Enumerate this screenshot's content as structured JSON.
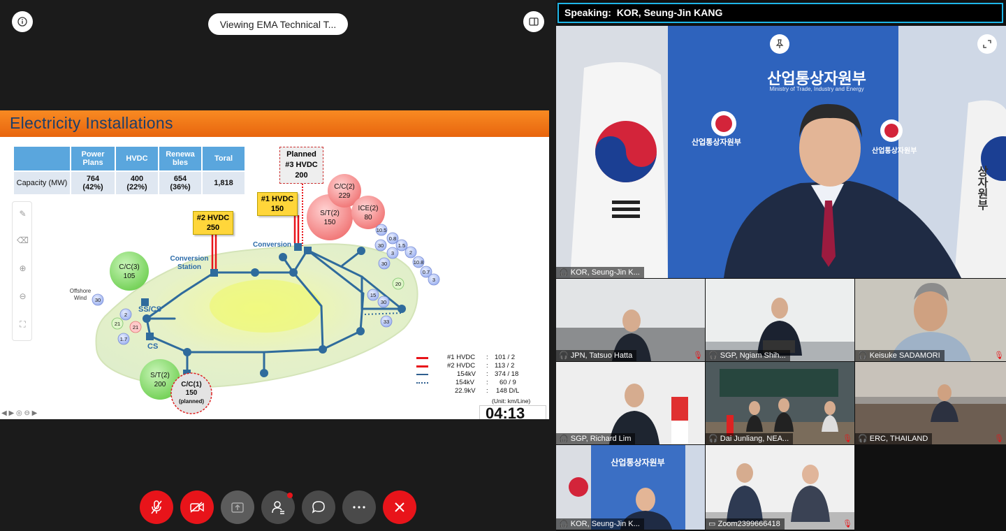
{
  "share": {
    "viewing_label": "Viewing EMA Technical T...",
    "slide": {
      "title": "Electricity Installations",
      "table": {
        "headers": [
          "",
          "Power Plans",
          "HVDC",
          "Renewa bles",
          "Toral"
        ],
        "row_label": "Capacity (MW)",
        "cells": [
          {
            "value": "764",
            "pct": "(42%)"
          },
          {
            "value": "400",
            "pct": "(22%)"
          },
          {
            "value": "654",
            "pct": "(36%)"
          },
          {
            "value": "1,818",
            "pct": ""
          }
        ]
      },
      "tags": {
        "hvdc2": {
          "line1": "#2 HVDC",
          "line2": "250"
        },
        "hvdc1": {
          "line1": "#1 HVDC",
          "line2": "150"
        },
        "planned3": {
          "line1": "Planned",
          "line2": "#3 HVDC",
          "line3": "200"
        }
      },
      "map_labels": {
        "conversion_station": "Conversion Station",
        "conversion": "Conversion",
        "offshore_wind": "Offshore Wind",
        "sscs": "SS/CS",
        "cs": "CS"
      },
      "plant_bubbles": {
        "cc3": {
          "name": "C/C(3)",
          "value": "105"
        },
        "cc2": {
          "name": "C/C(2)",
          "value": "229"
        },
        "st2_north": {
          "name": "S/T(2)",
          "value": "150"
        },
        "ice2": {
          "name": "ICE(2)",
          "value": "80"
        },
        "st2_south": {
          "name": "S/T(2)",
          "value": "200"
        },
        "cc1": {
          "name": "C/C(1)",
          "value": "150",
          "note": "(planned)"
        }
      },
      "small_bubbles": [
        "10.5",
        "0.8",
        "1.5",
        "30",
        "3",
        "2",
        "30",
        "10.8",
        "0.7",
        "3",
        "20",
        "15",
        "30",
        "33",
        "30",
        "2",
        "21",
        "21",
        "1.7"
      ],
      "legend": [
        {
          "name": "#1 HVDC",
          "value": "101 /  2",
          "color": "#e8141a",
          "style": "solid-red"
        },
        {
          "name": "#2 HVDC",
          "value": "113 /  2",
          "color": "#e8141a",
          "style": "solid-red"
        },
        {
          "name": "154kV",
          "value": "374 / 18",
          "color": "#2f5f8f",
          "style": "solid-blue"
        },
        {
          "name": "154kV",
          "value": "60 /  9",
          "color": "#2f5f8f",
          "style": "dotted-blue"
        },
        {
          "name": "22.9kV",
          "value": "148  D/L",
          "color": "",
          "style": "none"
        }
      ],
      "unit_note": "(Unit: km/Line)",
      "timer": "04:13"
    }
  },
  "controls": [
    {
      "name": "mute",
      "icon": "mic-off-icon"
    },
    {
      "name": "video",
      "icon": "video-off-icon"
    },
    {
      "name": "share",
      "icon": "share-icon"
    },
    {
      "name": "participants",
      "icon": "participants-icon"
    },
    {
      "name": "chat",
      "icon": "chat-icon"
    },
    {
      "name": "more",
      "icon": "more-icon"
    },
    {
      "name": "leave",
      "icon": "close-icon"
    }
  ],
  "gallery": {
    "speaking_prefix": "Speaking:",
    "speaking_name": "KOR, Seung-Jin KANG",
    "main_speaker": {
      "name": "KOR, Seung-Jin K...",
      "backdrop_korean": "산업통상자원부",
      "backdrop_english": "Ministry of Trade, Industry and Energy",
      "logo_korean": "산업통상자원부",
      "flag_right_text": "상자원부"
    },
    "tiles": [
      {
        "name": "JPN, Tatsuo Hatta",
        "muted": true
      },
      {
        "name": "SGP, Ngiam Shih...",
        "muted": false
      },
      {
        "name": "Keisuke SADAMORI",
        "muted": true
      },
      {
        "name": "SGP, Richard Lim",
        "muted": false
      },
      {
        "name": "Dai Junliang, NEA...",
        "muted": true
      },
      {
        "name": "ERC, THAILAND",
        "muted": true
      },
      {
        "name": "KOR, Seung-Jin K...",
        "muted": false
      },
      {
        "name": "Zoom2399666418",
        "muted": true
      }
    ]
  }
}
